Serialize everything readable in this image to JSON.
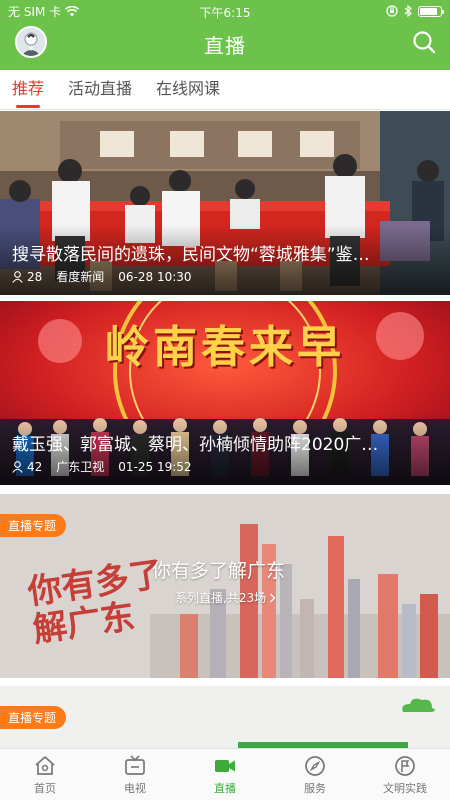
{
  "status_bar": {
    "carrier": "无 SIM 卡",
    "time": "下午6:15",
    "battery_level": 0.85
  },
  "header": {
    "title": "直播"
  },
  "tabs": [
    {
      "label": "推荐",
      "active": true
    },
    {
      "label": "活动直播",
      "active": false
    },
    {
      "label": "在线网课",
      "active": false
    }
  ],
  "feed": [
    {
      "title": "搜寻散落民间的遗珠，民间文物“蓉城雅集”鉴…",
      "viewers": "28",
      "source": "看度新闻",
      "time": "06-28 10:30"
    },
    {
      "title": "戴玉强、郭富城、蔡明、孙楠倾情助阵2020广…",
      "viewers": "42",
      "source": "广东卫视",
      "time": "01-25 19:52",
      "banner_text": "岭南春来早"
    }
  ],
  "specials": [
    {
      "badge": "直播专题",
      "title": "你有多了解广东",
      "subtitle": "系列直播,共23场",
      "art_text": "你有多了解广东"
    },
    {
      "badge": "直播专题"
    }
  ],
  "nav": [
    {
      "label": "首页",
      "icon": "home-icon",
      "active": false
    },
    {
      "label": "电视",
      "icon": "tv-icon",
      "active": false
    },
    {
      "label": "直播",
      "icon": "video-camera-icon",
      "active": true
    },
    {
      "label": "服务",
      "icon": "compass-icon",
      "active": false
    },
    {
      "label": "文明实践",
      "icon": "flag-circle-icon",
      "active": false
    }
  ],
  "colors": {
    "brand_green": "#6cc24a",
    "tab_active_red": "#e33b2f",
    "badge_orange": "#ff7b1a",
    "nav_active_green": "#3cab3a"
  }
}
